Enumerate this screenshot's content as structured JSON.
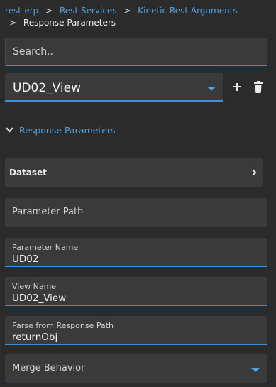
{
  "breadcrumb": {
    "items": [
      "rest-erp",
      "Rest Services",
      "Kinetic Rest Arguments"
    ],
    "separator": ">",
    "current": "Response Parameters"
  },
  "search": {
    "placeholder": "Search..",
    "value": ""
  },
  "view_select": {
    "value": "UD02_View"
  },
  "toolbar": {
    "add_icon": "plus-icon",
    "delete_icon": "trash-icon"
  },
  "section": {
    "title": "Response Parameters",
    "expanded": true
  },
  "dataset": {
    "label": "Dataset"
  },
  "fields": {
    "parameter_path": {
      "label": "Parameter Path",
      "value": ""
    },
    "parameter_name": {
      "label": "Parameter Name",
      "value": "UD02"
    },
    "view_name": {
      "label": "View Name",
      "value": "UD02_View"
    },
    "parse_from_response_path": {
      "label": "Parse from Response Path",
      "value": "returnObj"
    },
    "merge_behavior": {
      "label": "Merge Behavior",
      "value": ""
    }
  },
  "colors": {
    "background": "#2b2b2b",
    "panel": "#3a3a3a",
    "accent": "#4aa3ea",
    "underline": "#3c8fdc",
    "text": "#f0f0f0"
  }
}
